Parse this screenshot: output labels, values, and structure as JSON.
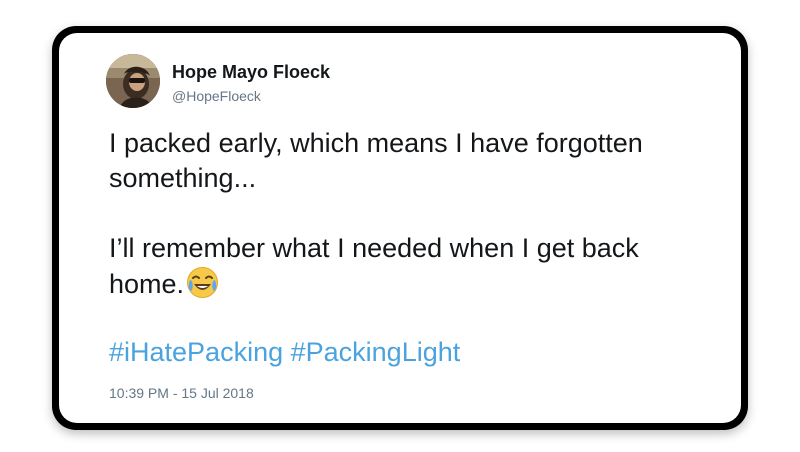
{
  "tweet": {
    "author_name": "Hope Mayo Floeck",
    "author_handle": "@HopeFloeck",
    "paragraphs": [
      "I packed early, which means I have forgotten something...",
      "I’ll remember what I needed when I get back home."
    ],
    "emoji": "face-with-tears-of-joy-icon",
    "hashtags": [
      "#iHatePacking",
      "#PackingLight"
    ],
    "timestamp": "10:39 PM - 15 Jul 2018",
    "hashtag_color": "#4aa3df",
    "text_color": "#14171a",
    "muted_color": "#657786"
  }
}
